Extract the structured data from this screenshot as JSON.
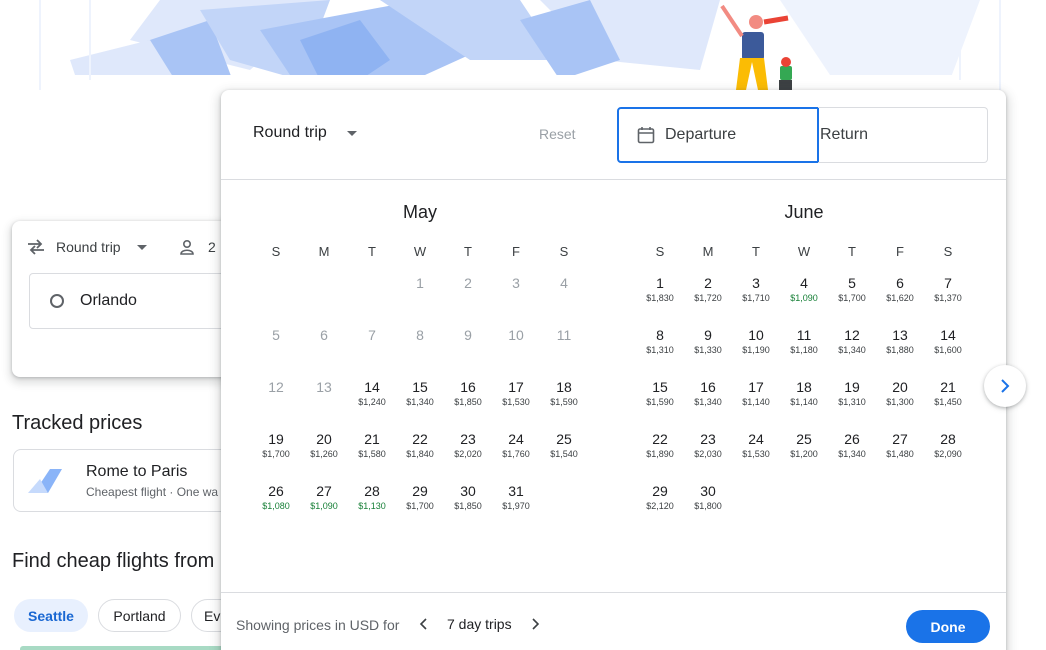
{
  "background": {
    "trip_type": "Round trip",
    "passengers": "2",
    "origin": "Orlando",
    "tracked_title": "Tracked prices",
    "tracked_item": {
      "name": "Rome to Paris",
      "sub": "Cheapest flight · One wa"
    },
    "find_title": "Find cheap flights from",
    "chips": [
      "Seattle",
      "Portland",
      "Ev"
    ]
  },
  "panel": {
    "trip_type": "Round trip",
    "reset_label": "Reset",
    "departure_placeholder": "Departure",
    "return_placeholder": "Return",
    "weekday_labels": [
      "S",
      "M",
      "T",
      "W",
      "T",
      "F",
      "S"
    ],
    "months": [
      {
        "name": "May",
        "lead_blanks": 3,
        "days": [
          {
            "d": "1",
            "p": "",
            "past": true
          },
          {
            "d": "2",
            "p": "",
            "past": true
          },
          {
            "d": "3",
            "p": "",
            "past": true
          },
          {
            "d": "4",
            "p": "",
            "past": true
          },
          {
            "d": "5",
            "p": "",
            "past": true
          },
          {
            "d": "6",
            "p": "",
            "past": true
          },
          {
            "d": "7",
            "p": "",
            "past": true
          },
          {
            "d": "8",
            "p": "",
            "past": true
          },
          {
            "d": "9",
            "p": "",
            "past": true
          },
          {
            "d": "10",
            "p": "",
            "past": true
          },
          {
            "d": "11",
            "p": "",
            "past": true
          },
          {
            "d": "12",
            "p": "",
            "past": true
          },
          {
            "d": "13",
            "p": "",
            "past": true
          },
          {
            "d": "14",
            "p": "$1,240"
          },
          {
            "d": "15",
            "p": "$1,340"
          },
          {
            "d": "16",
            "p": "$1,850"
          },
          {
            "d": "17",
            "p": "$1,530"
          },
          {
            "d": "18",
            "p": "$1,590"
          },
          {
            "d": "19",
            "p": "$1,700"
          },
          {
            "d": "20",
            "p": "$1,260"
          },
          {
            "d": "21",
            "p": "$1,580"
          },
          {
            "d": "22",
            "p": "$1,840"
          },
          {
            "d": "23",
            "p": "$2,020"
          },
          {
            "d": "24",
            "p": "$1,760"
          },
          {
            "d": "25",
            "p": "$1,540"
          },
          {
            "d": "26",
            "p": "$1,080",
            "cheap": true
          },
          {
            "d": "27",
            "p": "$1,090",
            "cheap": true
          },
          {
            "d": "28",
            "p": "$1,130",
            "cheap": true
          },
          {
            "d": "29",
            "p": "$1,700"
          },
          {
            "d": "30",
            "p": "$1,850"
          },
          {
            "d": "31",
            "p": "$1,970"
          }
        ]
      },
      {
        "name": "June",
        "lead_blanks": 0,
        "days": [
          {
            "d": "1",
            "p": "$1,830"
          },
          {
            "d": "2",
            "p": "$1,720"
          },
          {
            "d": "3",
            "p": "$1,710"
          },
          {
            "d": "4",
            "p": "$1,090",
            "cheap": true
          },
          {
            "d": "5",
            "p": "$1,700"
          },
          {
            "d": "6",
            "p": "$1,620"
          },
          {
            "d": "7",
            "p": "$1,370"
          },
          {
            "d": "8",
            "p": "$1,310"
          },
          {
            "d": "9",
            "p": "$1,330"
          },
          {
            "d": "10",
            "p": "$1,190"
          },
          {
            "d": "11",
            "p": "$1,180"
          },
          {
            "d": "12",
            "p": "$1,340"
          },
          {
            "d": "13",
            "p": "$1,880"
          },
          {
            "d": "14",
            "p": "$1,600"
          },
          {
            "d": "15",
            "p": "$1,590"
          },
          {
            "d": "16",
            "p": "$1,340"
          },
          {
            "d": "17",
            "p": "$1,140"
          },
          {
            "d": "18",
            "p": "$1,140"
          },
          {
            "d": "19",
            "p": "$1,310"
          },
          {
            "d": "20",
            "p": "$1,300"
          },
          {
            "d": "21",
            "p": "$1,450"
          },
          {
            "d": "22",
            "p": "$1,890"
          },
          {
            "d": "23",
            "p": "$2,030"
          },
          {
            "d": "24",
            "p": "$1,530"
          },
          {
            "d": "25",
            "p": "$1,200"
          },
          {
            "d": "26",
            "p": "$1,340"
          },
          {
            "d": "27",
            "p": "$1,480"
          },
          {
            "d": "28",
            "p": "$2,090"
          },
          {
            "d": "29",
            "p": "$2,120"
          },
          {
            "d": "30",
            "p": "$1,800"
          }
        ]
      }
    ],
    "footer": {
      "label": "Showing prices in USD for",
      "trip_length": "7 day trips",
      "done_label": "Done"
    }
  },
  "colors": {
    "accent": "#1a73e8",
    "cheap_price": "#188038",
    "past_day": "#9aa0a6"
  }
}
